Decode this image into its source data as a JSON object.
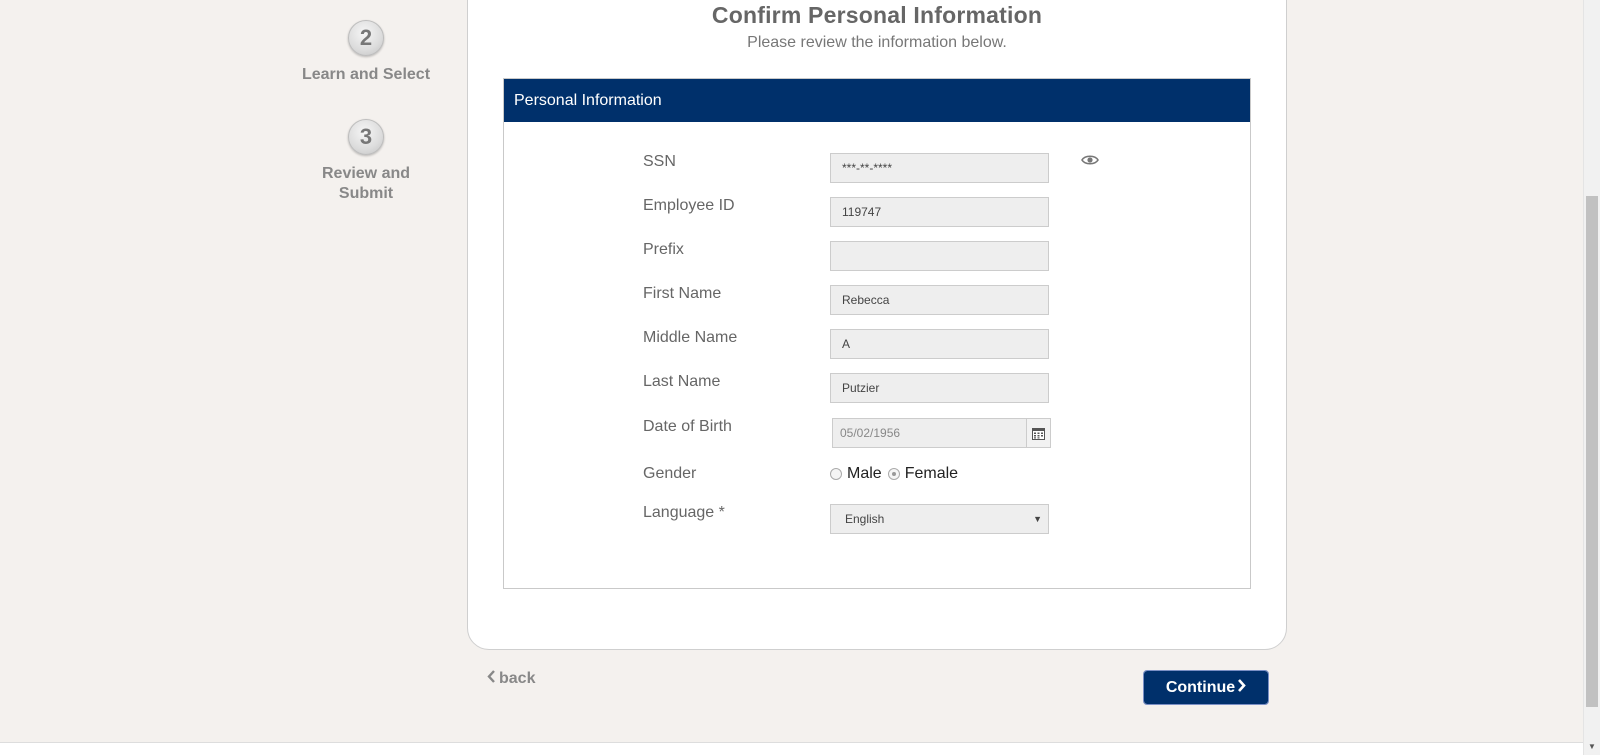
{
  "steps": [
    {
      "number": "2",
      "label": "Learn and Select"
    },
    {
      "number": "3",
      "label": "Review and Submit"
    }
  ],
  "header": {
    "title": "Confirm Personal Information",
    "subtitle": "Please review the information below."
  },
  "panel": {
    "title": "Personal Information",
    "fields": {
      "ssn": {
        "label": "SSN",
        "value": "***-**-****"
      },
      "employee_id": {
        "label": "Employee ID",
        "value": "119747"
      },
      "prefix": {
        "label": "Prefix",
        "value": ""
      },
      "first_name": {
        "label": "First Name",
        "value": "Rebecca"
      },
      "middle_name": {
        "label": "Middle Name",
        "value": "A"
      },
      "last_name": {
        "label": "Last Name",
        "value": "Putzier"
      },
      "dob": {
        "label": "Date of Birth",
        "value": "05/02/1956"
      },
      "gender": {
        "label": "Gender",
        "options": [
          "Male",
          "Female"
        ],
        "selected": "Female"
      },
      "language": {
        "label": "Language *",
        "value": "English"
      }
    }
  },
  "nav": {
    "back_label": "back",
    "continue_label": "Continue"
  },
  "colors": {
    "brand": "#00306b",
    "background": "#f4f1ee"
  }
}
